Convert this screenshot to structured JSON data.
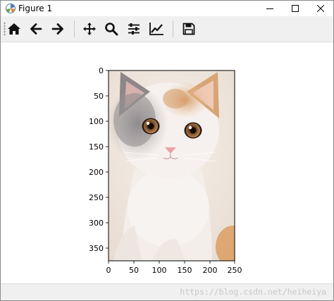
{
  "window": {
    "title": "Figure 1"
  },
  "toolbar": {
    "buttons": [
      {
        "name": "home-icon"
      },
      {
        "name": "back-arrow-icon"
      },
      {
        "name": "forward-arrow-icon"
      },
      {
        "name": "pan-move-icon"
      },
      {
        "name": "zoom-magnifier-icon"
      },
      {
        "name": "subplots-sliders-icon"
      },
      {
        "name": "axes-line-chart-icon"
      },
      {
        "name": "save-disk-icon"
      }
    ]
  },
  "figure": {
    "xticks": [
      "0",
      "50",
      "100",
      "150",
      "200",
      "250"
    ],
    "yticks": [
      "0",
      "50",
      "100",
      "150",
      "200",
      "250",
      "300",
      "350"
    ],
    "image_content": "kitten photo"
  },
  "status": {
    "watermark": "https://blog.csdn.net/heiheiya"
  }
}
